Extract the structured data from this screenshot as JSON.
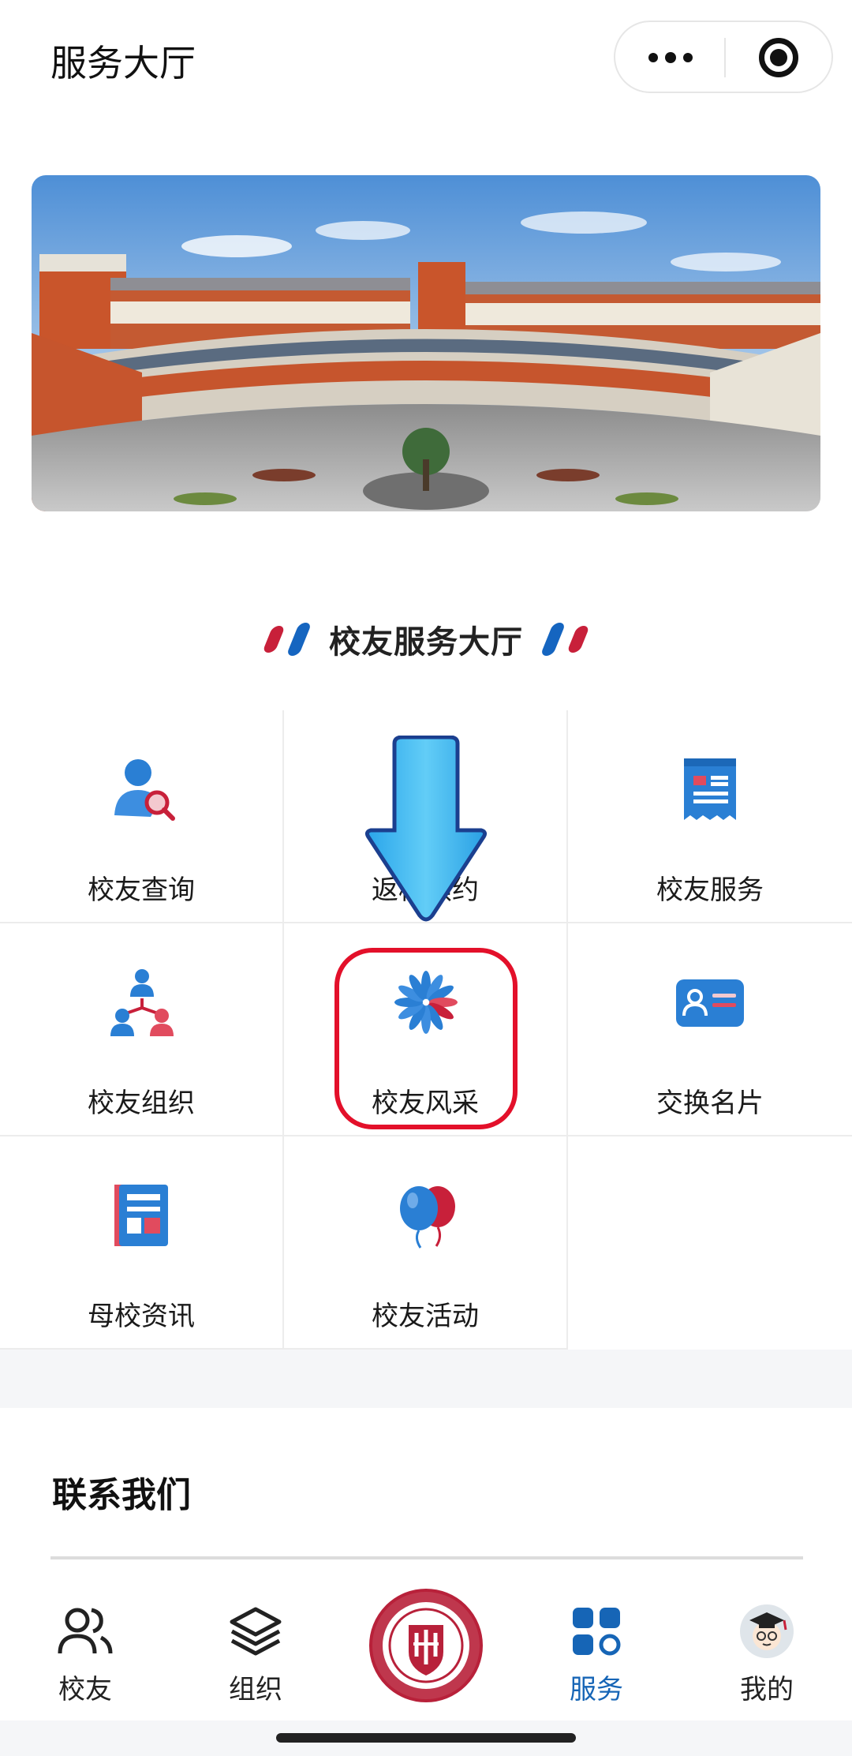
{
  "header": {
    "title": "服务大厅",
    "more_icon": "more-dots-icon",
    "close_icon": "target-circle-icon"
  },
  "section": {
    "title": "校友服务大厅"
  },
  "services": [
    {
      "label": "校友查询",
      "icon": "alumni-search-icon"
    },
    {
      "label": "返校预约",
      "icon": "campus-return-icon"
    },
    {
      "label": "校友服务",
      "icon": "service-document-icon"
    },
    {
      "label": "校友组织",
      "icon": "organization-icon"
    },
    {
      "label": "校友风采",
      "icon": "pinwheel-icon"
    },
    {
      "label": "交换名片",
      "icon": "business-card-icon"
    },
    {
      "label": "母校资讯",
      "icon": "news-icon"
    },
    {
      "label": "校友活动",
      "icon": "balloons-icon"
    }
  ],
  "contact": {
    "title": "联系我们"
  },
  "tabbar": {
    "items": [
      {
        "label": "校友",
        "icon": "people-icon"
      },
      {
        "label": "组织",
        "icon": "layers-icon"
      },
      {
        "label": "",
        "icon": "university-logo-icon"
      },
      {
        "label": "服务",
        "icon": "grid-apps-icon"
      },
      {
        "label": "我的",
        "icon": "avatar-icon"
      }
    ]
  },
  "colors": {
    "accent_blue": "#1665b6",
    "accent_red": "#c8203a",
    "highlight_red": "#e3102a",
    "arrow_blue": "#3fb8f0"
  }
}
